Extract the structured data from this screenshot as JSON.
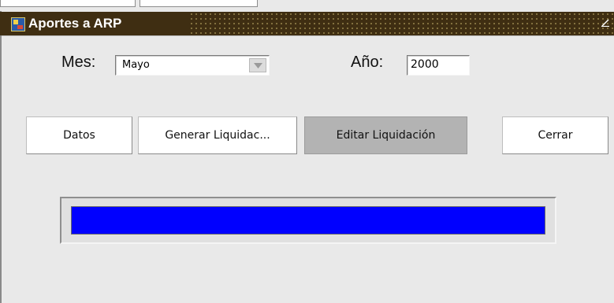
{
  "window": {
    "title": "Aportes a ARP"
  },
  "form": {
    "mes_label": "Mes:",
    "mes_value": "Mayo",
    "anio_label": "Año:",
    "anio_value": "2000"
  },
  "buttons": {
    "datos": "Datos",
    "generar": "Generar Liquidac...",
    "editar": "Editar Liquidación",
    "cerrar": "Cerrar"
  },
  "progress": {
    "fraction": 1.0,
    "color": "#0000ff"
  },
  "colors": {
    "titlebar": "#3f2e12",
    "window_bg": "#e9e9e9",
    "progress_fill": "#0000ff"
  },
  "icons": {
    "app": "form-app-icon",
    "minimize": "minimize-icon",
    "dropdown": "chevron-down-icon"
  }
}
